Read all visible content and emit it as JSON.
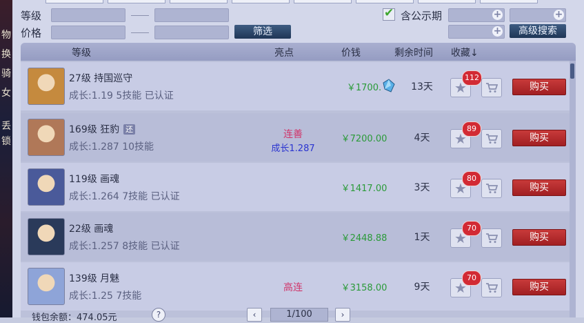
{
  "side_chars": [
    "物",
    "换",
    "骑",
    "女",
    "丢",
    "锁"
  ],
  "filters": {
    "level_label": "等级",
    "price_label": "价格",
    "filter_button": "筛选",
    "public_label": "含公示期",
    "advanced_button": "高级搜索"
  },
  "table": {
    "headers": {
      "level": "等级",
      "highlight": "亮点",
      "price": "价钱",
      "remaining": "剩余时间",
      "favorite": "收藏↓"
    },
    "buy_label": "购买",
    "rows": [
      {
        "level_name": "27级  持国巡守",
        "growth": "成长:1.19  5技能  已认证",
        "tag": "",
        "hl1": "",
        "hl2": "",
        "price": "￥1700.",
        "days": "13天",
        "favs": "112",
        "avatar_color": "#c58a3e"
      },
      {
        "level_name": "169级  狂豹",
        "growth": "成长:1.287  10技能",
        "tag": "还",
        "hl1": "连善",
        "hl2": "成长1.287",
        "price": "￥7200.00",
        "days": "4天",
        "favs": "89",
        "avatar_color": "#b07858"
      },
      {
        "level_name": "119级  画魂",
        "growth": "成长:1.264  7技能  已认证",
        "tag": "",
        "hl1": "",
        "hl2": "",
        "price": "￥1417.00",
        "days": "3天",
        "favs": "80",
        "avatar_color": "#4a5a9a"
      },
      {
        "level_name": "22级  画魂",
        "growth": "成长:1.257  8技能  已认证",
        "tag": "",
        "hl1": "",
        "hl2": "",
        "price": "￥2448.88",
        "days": "1天",
        "favs": "70",
        "avatar_color": "#2a3a5a"
      },
      {
        "level_name": "139级  月魅",
        "growth": "成长:1.25  7技能",
        "tag": "",
        "hl1": "高连",
        "hl2": "",
        "price": "￥3158.00",
        "days": "9天",
        "favs": "70",
        "avatar_color": "#8ea4d8"
      }
    ]
  },
  "footer": {
    "wallet": "钱包余额：474.05元",
    "help": "?",
    "prev": "‹",
    "page": "1/100",
    "next": "›"
  }
}
